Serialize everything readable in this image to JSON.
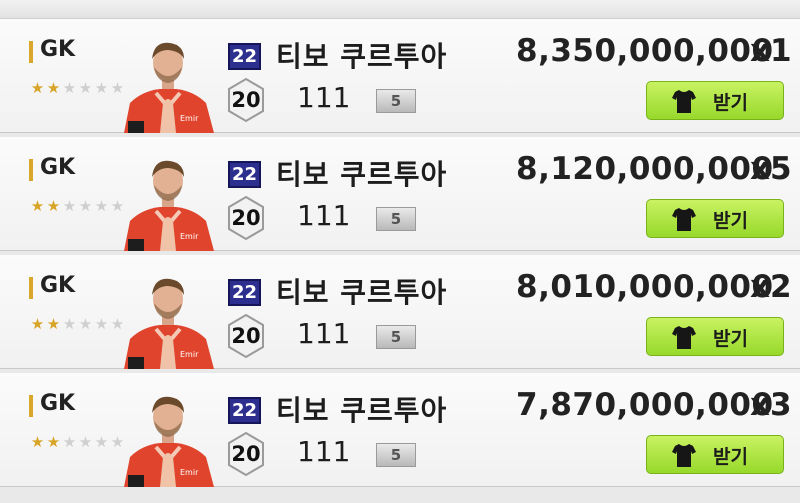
{
  "rows": [
    {
      "position": "GK",
      "stars_filled": 2,
      "stars_total": 6,
      "season": "22",
      "level": "20",
      "name": "티보 쿠르투아",
      "ovr": "111",
      "grade": "5",
      "price": "8,350,000,000",
      "qty": "x1",
      "button_label": "받기"
    },
    {
      "position": "GK",
      "stars_filled": 2,
      "stars_total": 6,
      "season": "22",
      "level": "20",
      "name": "티보 쿠르투아",
      "ovr": "111",
      "grade": "5",
      "price": "8,120,000,000",
      "qty": "x5",
      "button_label": "받기"
    },
    {
      "position": "GK",
      "stars_filled": 2,
      "stars_total": 6,
      "season": "22",
      "level": "20",
      "name": "티보 쿠르투아",
      "ovr": "111",
      "grade": "5",
      "price": "8,010,000,000",
      "qty": "x2",
      "button_label": "받기"
    },
    {
      "position": "GK",
      "stars_filled": 2,
      "stars_total": 6,
      "season": "22",
      "level": "20",
      "name": "티보 쿠르투아",
      "ovr": "111",
      "grade": "5",
      "price": "7,870,000,000",
      "qty": "x3",
      "button_label": "받기"
    }
  ],
  "icons": {
    "button": "jersey-icon",
    "player": "player-portrait"
  },
  "colors": {
    "position_accent": "#d9a72b",
    "season_badge": "#2d2f8f",
    "button_green": "#a6e03a",
    "star_on": "#d8a427"
  }
}
